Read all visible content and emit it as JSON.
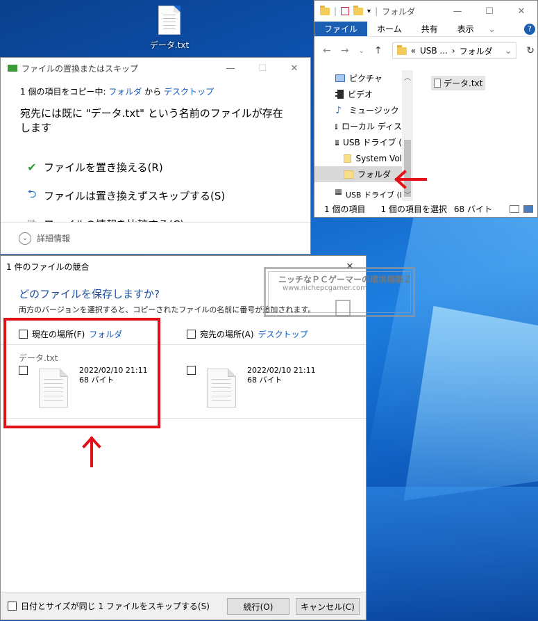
{
  "desktop": {
    "icon_label": "データ.txt"
  },
  "explorer": {
    "title": "フォルダ",
    "ribbon_tabs": [
      "ファイル",
      "ホーム",
      "共有",
      "表示"
    ],
    "address": [
      "USB ...",
      "フォルダ"
    ],
    "nav_items": [
      "ピクチャ",
      "ビデオ",
      "ミュージック",
      "ローカル ディス",
      "USB ドライブ (",
      "System Vol",
      "フォルダ",
      "USB ドライブ (I"
    ],
    "file_item": "データ.txt",
    "status": {
      "count": "1 個の項目",
      "selected": "1 個の項目を選択",
      "size": "68 バイト"
    }
  },
  "replace_dialog": {
    "title": "ファイルの置換またはスキップ",
    "copy_prefix": "1 個の項目をコピー中:",
    "from": "フォルダ",
    "from_to": "から",
    "to": "デスクトップ",
    "heading": "宛先には既に \"データ.txt\" という名前のファイルが存在します",
    "options": [
      {
        "label": "ファイルを置き換える(R)"
      },
      {
        "label": "ファイルは置き換えずスキップする(S)"
      },
      {
        "label": "ファイルの情報を比較する(C)"
      }
    ],
    "details": "詳細情報"
  },
  "conflict_dialog": {
    "title": "1 件のファイルの競合",
    "question": "どのファイルを保存しますか?",
    "subtitle": "両方のバージョンを選択すると、コピーされたファイルの名前に番号が追加されます。",
    "source_label": "現在の場所(F)",
    "source_link": "フォルダ",
    "dest_label": "宛先の場所(A)",
    "dest_link": "デスクトップ",
    "file_name": "データ.txt",
    "source_file": {
      "date": "2022/02/10 21:11",
      "size": "68 バイト"
    },
    "dest_file": {
      "date": "2022/02/10 21:11",
      "size": "68 バイト"
    },
    "skip_label": "日付とサイズが同じ 1 ファイルをスキップする(S)",
    "continue_button": "続行(O)",
    "cancel_button": "キャンセル(C)"
  },
  "watermark": {
    "title": "ニッチなＰＣゲーマーの環境構築Ｚ",
    "url": "www.nichepcgamer.com"
  },
  "colors": {
    "annotation_red": "#e3101a",
    "link_blue": "#0a58c4",
    "accent": "#1a5fb4"
  }
}
